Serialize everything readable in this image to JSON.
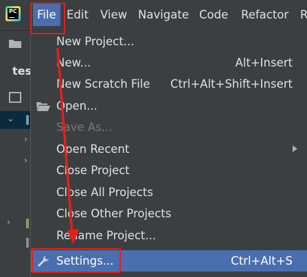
{
  "menubar": {
    "items": [
      {
        "label": "File"
      },
      {
        "label": "Edit"
      },
      {
        "label": "View"
      },
      {
        "label": "Navigate"
      },
      {
        "label": "Code"
      },
      {
        "label": "Refactor"
      },
      {
        "label": "R"
      }
    ]
  },
  "background": {
    "project_label": "tes"
  },
  "file_menu": {
    "items": [
      {
        "label": "New Project...",
        "shortcut": ""
      },
      {
        "label": "New...",
        "shortcut": "Alt+Insert"
      },
      {
        "label": "New Scratch File",
        "shortcut": "Ctrl+Alt+Shift+Insert"
      },
      {
        "label": "Open...",
        "shortcut": "",
        "icon": "folder-open-icon"
      },
      {
        "label": "Save As...",
        "shortcut": "",
        "disabled": true
      },
      {
        "label": "Open Recent",
        "shortcut": "",
        "submenu": true
      },
      {
        "label": "Close Project",
        "shortcut": ""
      },
      {
        "label": "Close All Projects",
        "shortcut": ""
      },
      {
        "label": "Close Other Projects",
        "shortcut": ""
      },
      {
        "label": "Rename Project...",
        "shortcut": ""
      },
      {
        "label": "Settings...",
        "shortcut": "Ctrl+Alt+S",
        "icon": "wrench-icon",
        "selected": true
      }
    ]
  },
  "colors": {
    "background": "#3c3f41",
    "selection": "#4b6eaf",
    "annotation": "#e0211e",
    "text": "#dfe1e5",
    "disabled_text": "#777777"
  }
}
